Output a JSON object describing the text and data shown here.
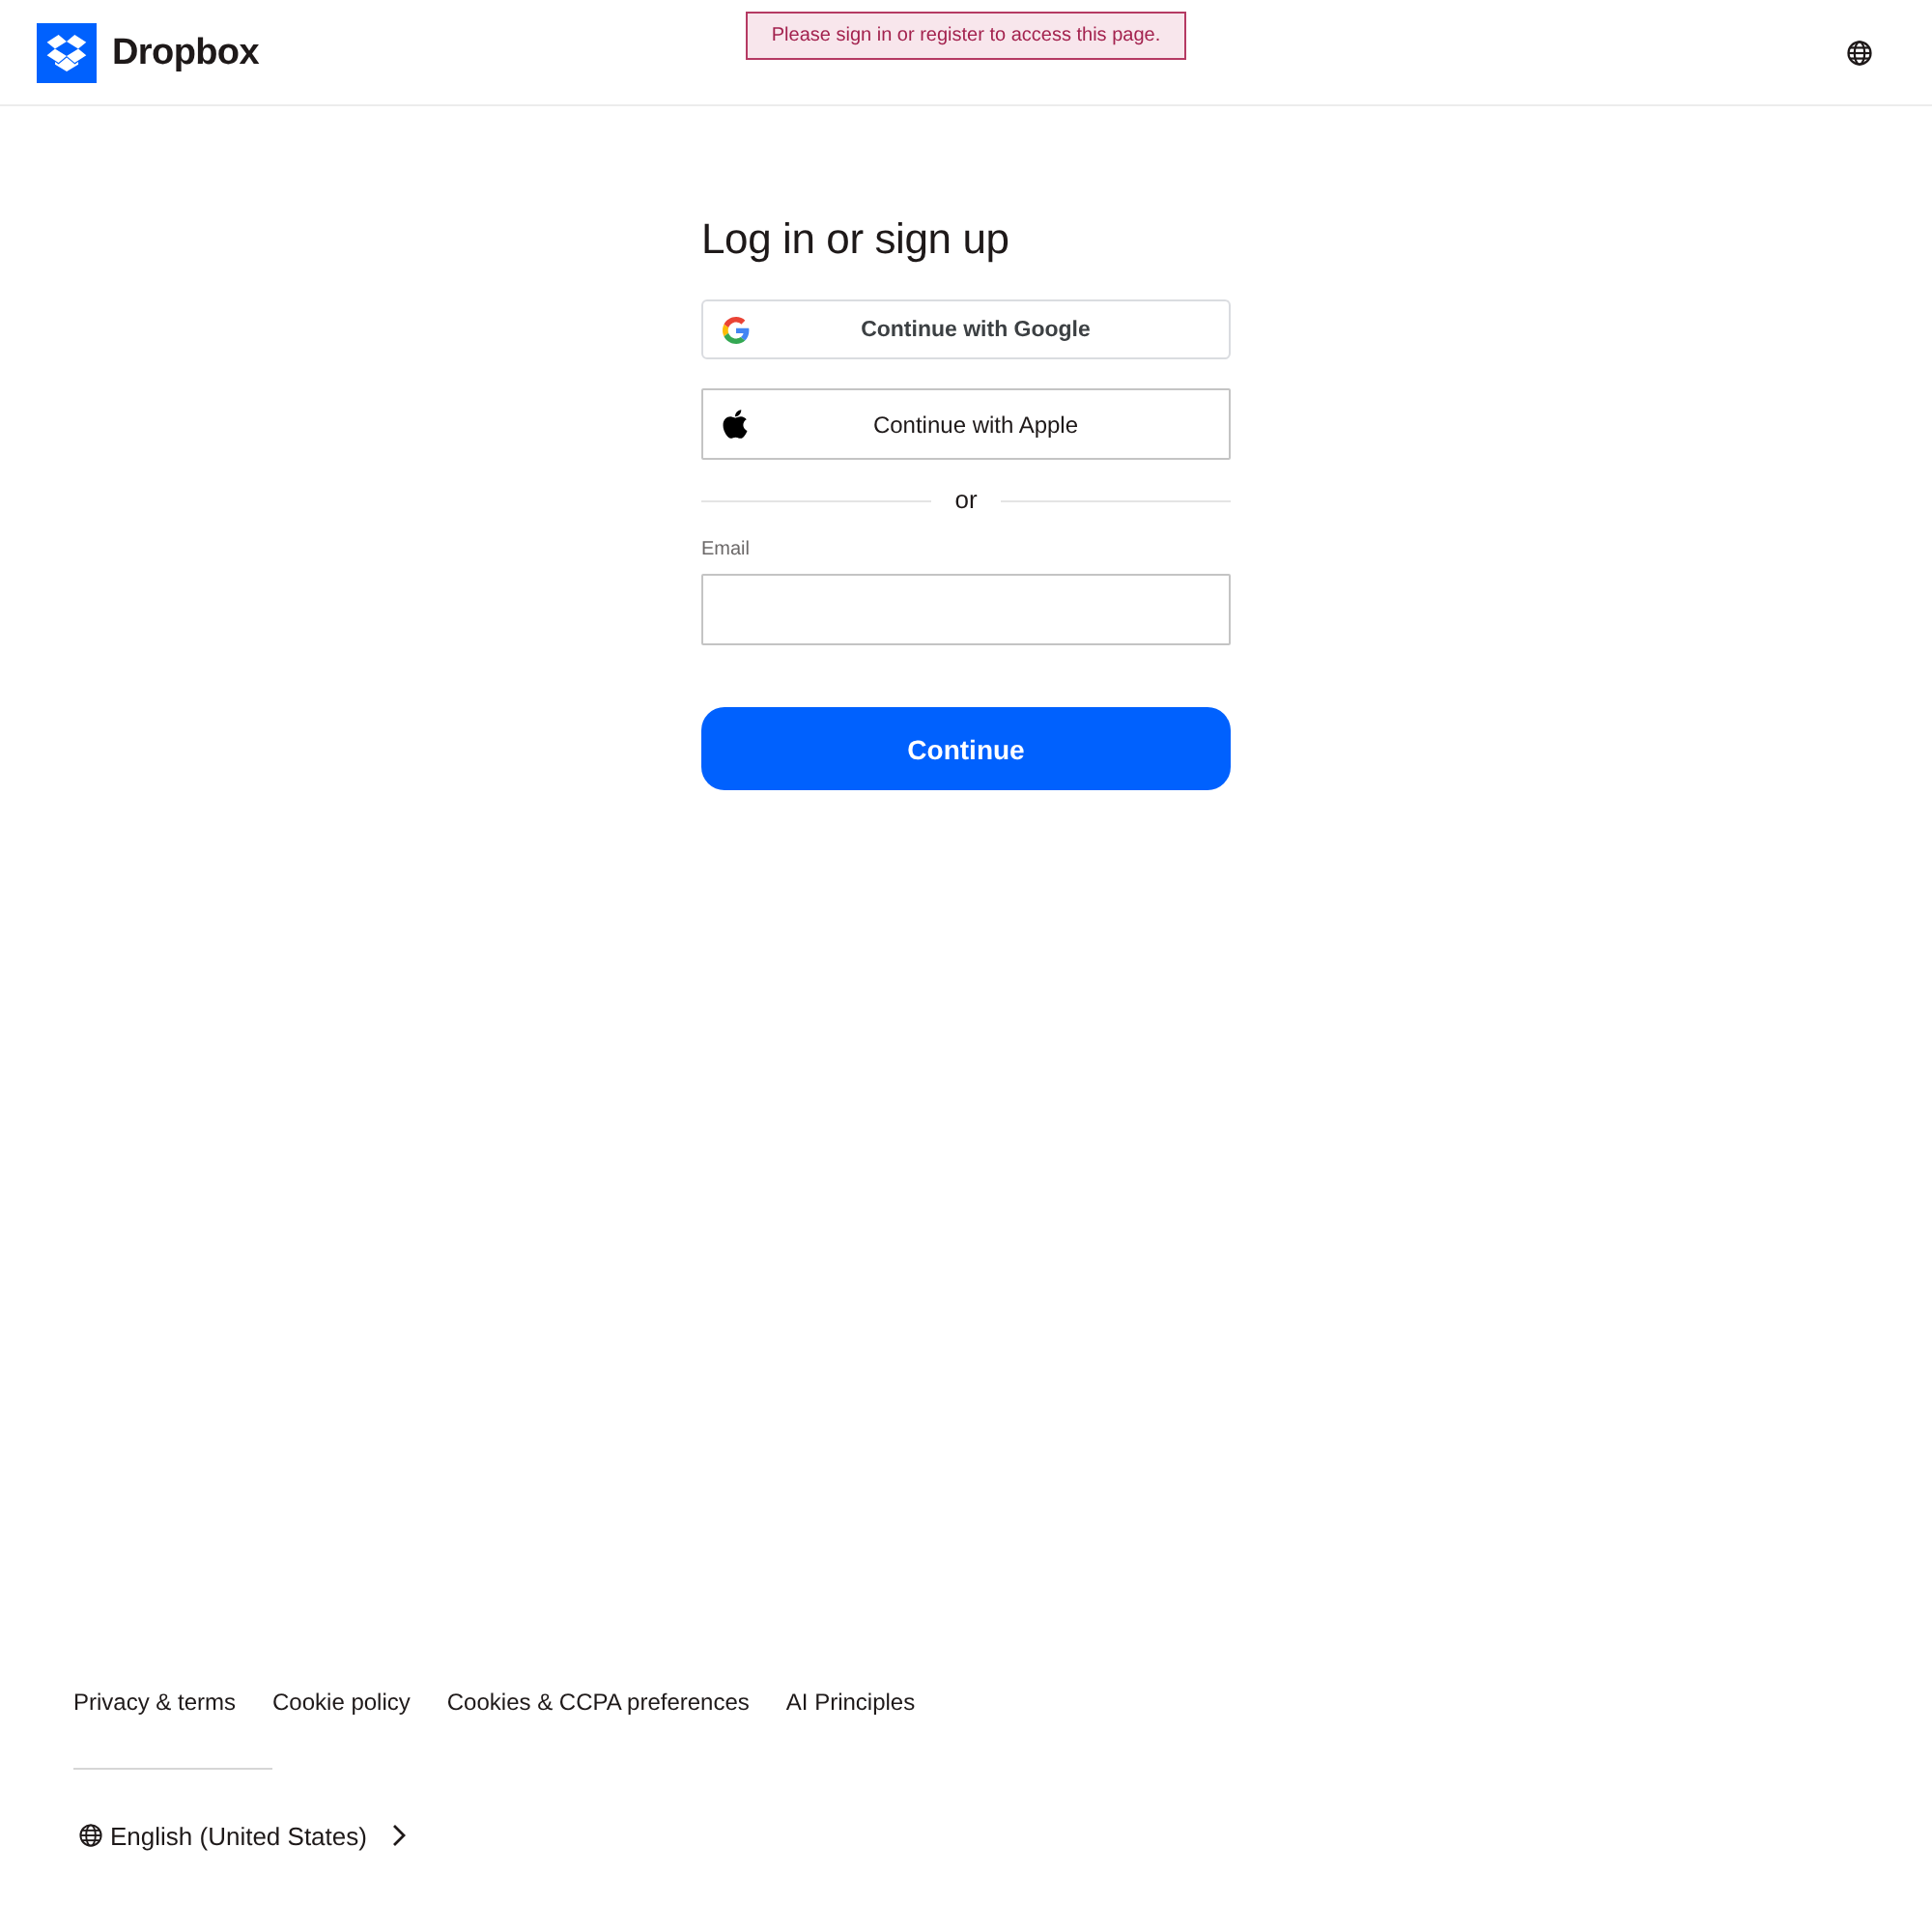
{
  "header": {
    "logo": {
      "label": "Dropbox"
    },
    "alert": {
      "text": "Please sign in or register to access this page."
    }
  },
  "login": {
    "title": "Log in or sign up",
    "providers": [
      {
        "kind": "google",
        "label": "Continue with Google"
      },
      {
        "kind": "apple",
        "label": "Continue with Apple"
      }
    ],
    "divider": "or",
    "email": {
      "label": "Email"
    },
    "submit": "Continue"
  },
  "footer": {
    "links": [
      "Privacy & terms",
      "Cookie policy",
      "Cookies & CCPA preferences",
      "AI Principles"
    ],
    "language": "English (United States)"
  }
}
